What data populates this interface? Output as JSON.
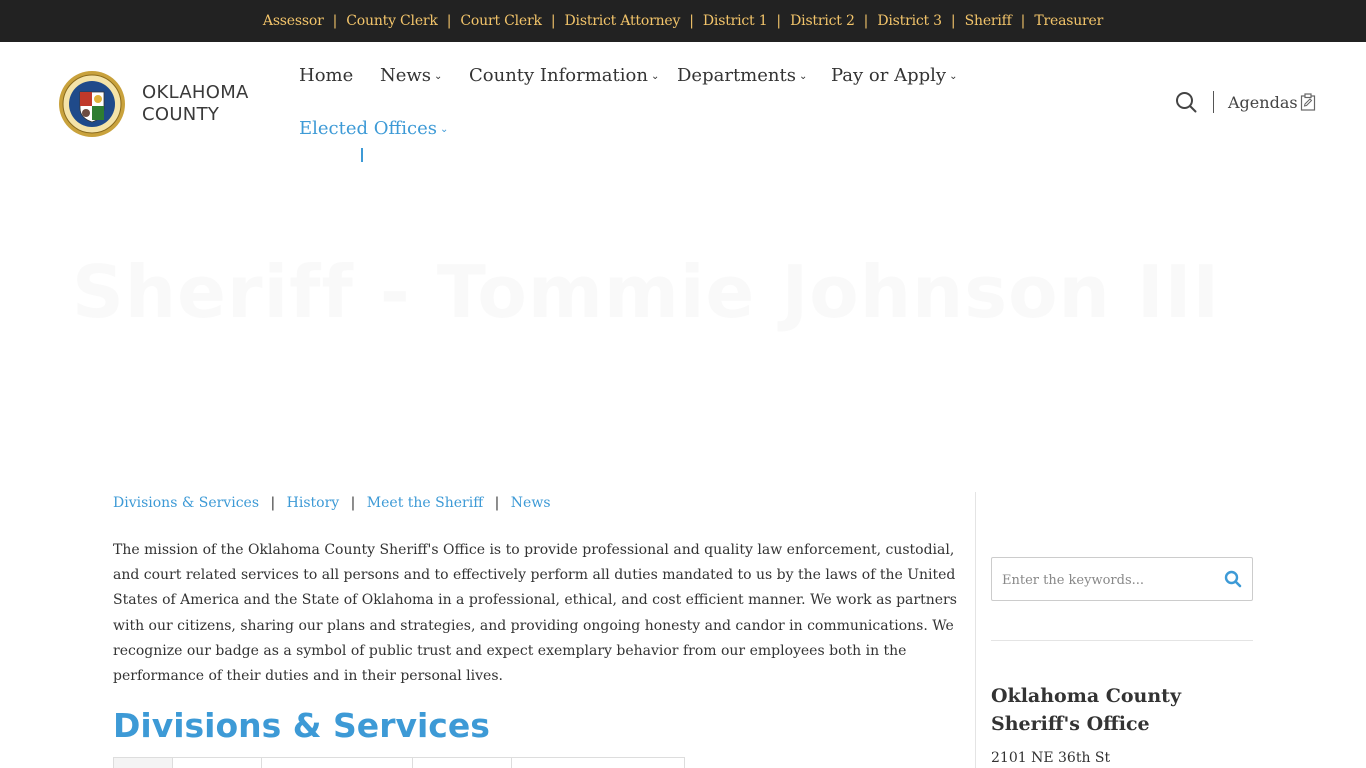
{
  "topbar": {
    "links": [
      "Assessor",
      "County Clerk",
      "Court Clerk",
      "District Attorney",
      "District 1",
      "District 2",
      "District 3",
      "Sheriff",
      "Treasurer"
    ],
    "separator": "|"
  },
  "header": {
    "logo_line1": "OKLAHOMA",
    "logo_line2": "COUNTY",
    "nav": {
      "home": "Home",
      "news": "News",
      "county_info": "County Information",
      "departments": "Departments",
      "pay_apply": "Pay or Apply",
      "elected_offices": "Elected Offices"
    },
    "agendas_label": "Agendas"
  },
  "hero": {
    "title": "Sheriff - Tommie Johnson III"
  },
  "subnav": {
    "items": [
      "Divisions & Services",
      "History",
      "Meet the Sheriff",
      "News"
    ],
    "separator": "|"
  },
  "main": {
    "mission": "The mission of the Oklahoma County Sheriff's Office is to provide professional and quality law enforcement, custodial, and court related services to all persons and to effectively perform all duties mandated to us by the laws of the United States of America and the State of Oklahoma in a professional, ethical, and cost efficient manner. We work as partners with our citizens, sharing our plans and strategies, and providing ongoing honesty and candor in communications. We recognize our badge as a symbol of public trust and expect exemplary behavior from our employees both in the performance of their duties and in their personal lives.",
    "section_title": "Divisions & Services"
  },
  "sidebar": {
    "search_placeholder": "Enter the keywords...",
    "office_title": "Oklahoma County Sheriff's Office",
    "address_line1": "2101 NE 36th St"
  },
  "colors": {
    "accent": "#3d9ad6",
    "topbar_bg": "#222222",
    "topbar_link": "#f2c46a"
  }
}
